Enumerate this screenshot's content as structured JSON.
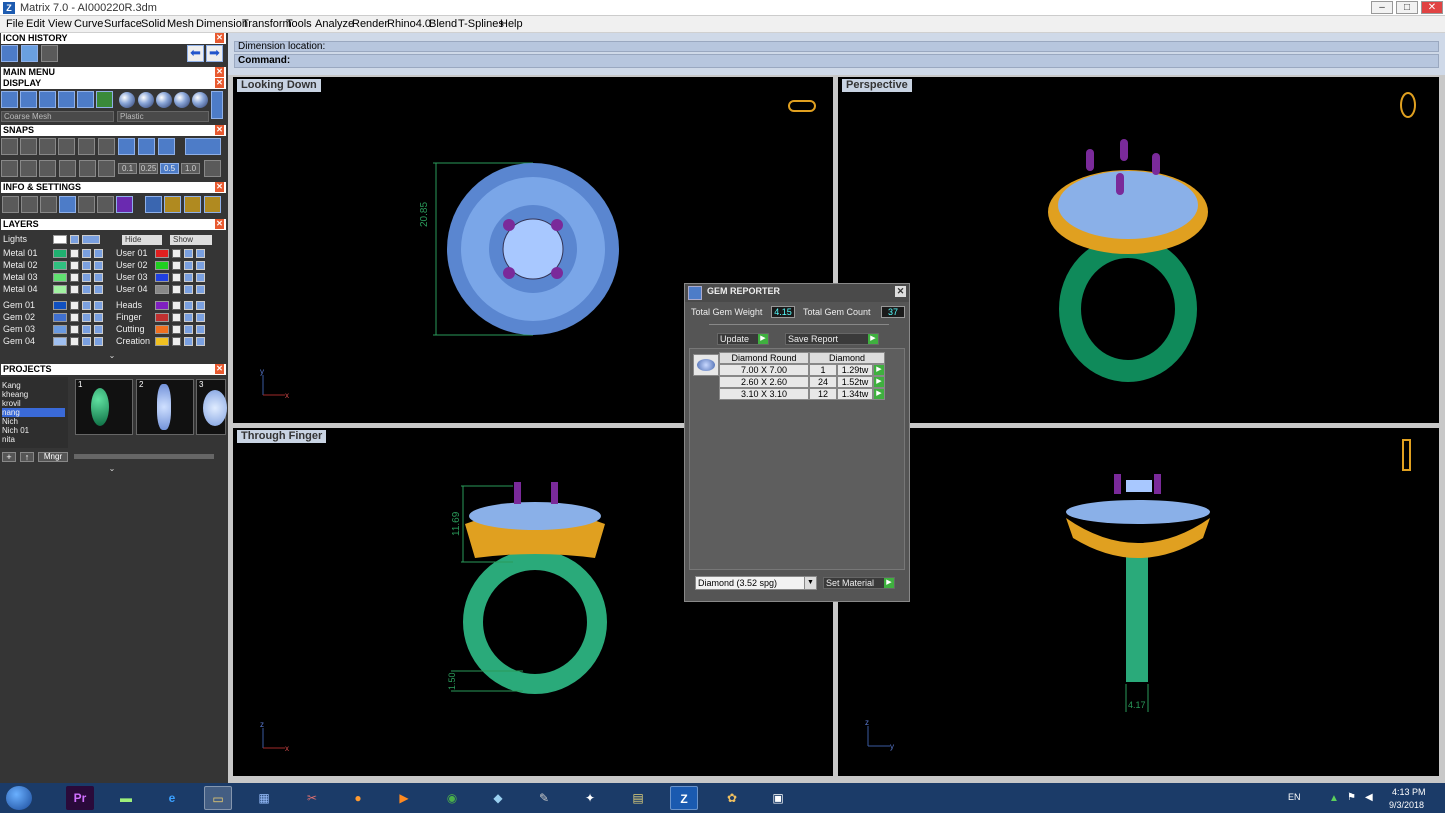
{
  "window": {
    "title": "Matrix 7.0 - AI000220R.3dm",
    "min": "–",
    "max": "□",
    "close": "✕"
  },
  "menu": [
    "File",
    "Edit",
    "View",
    "Curve",
    "Surface",
    "Solid",
    "Mesh",
    "Dimension",
    "Transform",
    "Tools",
    "Analyze",
    "Render",
    "Rhino4.0",
    "Blend",
    "T-Splines",
    "Help"
  ],
  "panels": {
    "icon_history": "ICON HISTORY",
    "main_menu": "MAIN MENU",
    "display": "DISPLAY",
    "snaps": "SNAPS",
    "info_settings": "INFO & SETTINGS",
    "layers": "LAYERS",
    "projects": "PROJECTS"
  },
  "display": {
    "mesh": "Coarse Mesh",
    "material": "Plastic"
  },
  "snaps": {
    "values": [
      "0.1",
      "0.25",
      "0.5",
      "1.0"
    ]
  },
  "layers": {
    "lights": "Lights",
    "hide": "Hide",
    "show": "Show",
    "left": [
      {
        "name": "Metal 01",
        "color": "#20b070"
      },
      {
        "name": "Metal 02",
        "color": "#30c080"
      },
      {
        "name": "Metal 03",
        "color": "#60e070"
      },
      {
        "name": "Metal 04",
        "color": "#a0f0a0"
      },
      {
        "name": "Gem 01",
        "color": "#1050c0"
      },
      {
        "name": "Gem 02",
        "color": "#4070d0"
      },
      {
        "name": "Gem 03",
        "color": "#6a9ae0"
      },
      {
        "name": "Gem 04",
        "color": "#a0c0f0"
      }
    ],
    "right": [
      {
        "name": "User 01",
        "color": "#e02020"
      },
      {
        "name": "User 02",
        "color": "#20d020"
      },
      {
        "name": "User 03",
        "color": "#2040e0"
      },
      {
        "name": "User 04",
        "color": "#888888"
      },
      {
        "name": "Heads",
        "color": "#8020c0"
      },
      {
        "name": "Finger",
        "color": "#c03030"
      },
      {
        "name": "Cutting",
        "color": "#f07020"
      },
      {
        "name": "Creation",
        "color": "#f0c020"
      }
    ]
  },
  "projects": {
    "list": [
      "Kang",
      "kheang",
      "krovil",
      "nang",
      "Nich",
      "Nich 01",
      "nita"
    ],
    "selected": "nang",
    "thumbs": [
      "1",
      "2",
      "3"
    ],
    "mngr": "Mngr"
  },
  "command": {
    "line1": "Dimension location:",
    "label": "Command:"
  },
  "viewports": {
    "top_left": "Looking Down",
    "top_right": "Perspective",
    "bottom_left": "Through Finger",
    "bottom_right": ""
  },
  "dims": {
    "top": "20.85",
    "front_height": "11.69",
    "front_bottom": "1.50",
    "side_width": "4.17"
  },
  "axes": {
    "tl": [
      "y",
      "x"
    ],
    "bl": [
      "z",
      "x"
    ],
    "br": [
      "z",
      "y"
    ]
  },
  "gem_reporter": {
    "title": "GEM REPORTER",
    "weight_label": "Total Gem Weight",
    "weight": "4.15",
    "count_label": "Total Gem Count",
    "count": "37",
    "update": "Update",
    "save": "Save Report",
    "headers": [
      "Diamond Round",
      "Diamond"
    ],
    "rows": [
      {
        "size": "7.00 X 7.00",
        "qty": "1",
        "tw": "1.29tw"
      },
      {
        "size": "2.60 X 2.60",
        "qty": "24",
        "tw": "1.52tw"
      },
      {
        "size": "3.10 X 3.10",
        "qty": "12",
        "tw": "1.34tw"
      }
    ],
    "material": "Diamond    (3.52 spg)",
    "set_material": "Set Material"
  },
  "taskbar": {
    "lang": "EN",
    "time": "4:13 PM",
    "date": "9/3/2018"
  }
}
